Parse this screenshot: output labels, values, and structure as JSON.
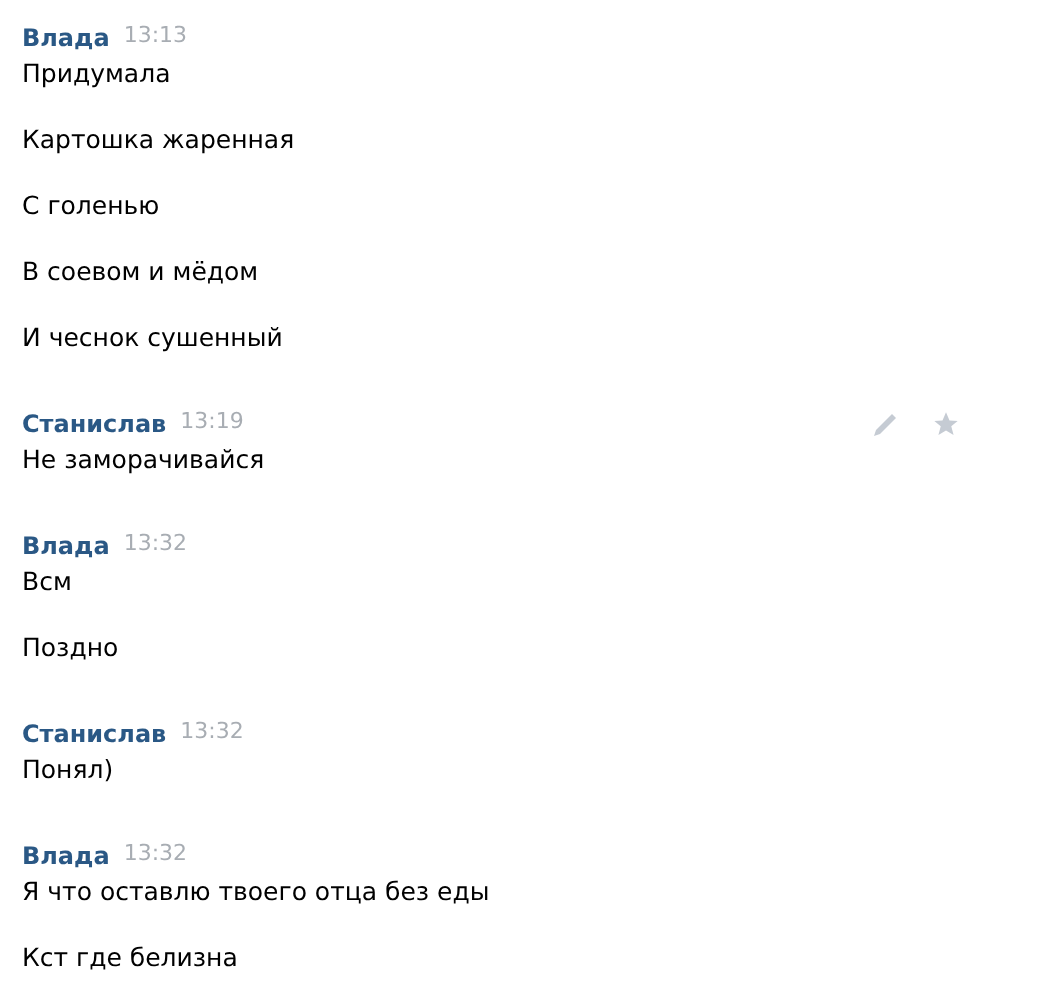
{
  "messages": [
    {
      "author": "Влада",
      "time": "13:13",
      "actions_visible": false,
      "lines": [
        "Придумала",
        "Картошка жаренная",
        "С голенью",
        "В соевом и мёдом",
        "И чеснок сушенный"
      ]
    },
    {
      "author": "Станислав",
      "time": "13:19",
      "actions_visible": true,
      "lines": [
        "Не заморачивайся"
      ]
    },
    {
      "author": "Влада",
      "time": "13:32",
      "actions_visible": false,
      "lines": [
        "Всм",
        "Поздно"
      ]
    },
    {
      "author": "Станислав",
      "time": "13:32",
      "actions_visible": false,
      "lines": [
        "Понял)"
      ]
    },
    {
      "author": "Влада",
      "time": "13:32",
      "actions_visible": false,
      "lines": [
        "Я что оставлю твоего отца без еды",
        "Кст где белизна"
      ]
    }
  ]
}
